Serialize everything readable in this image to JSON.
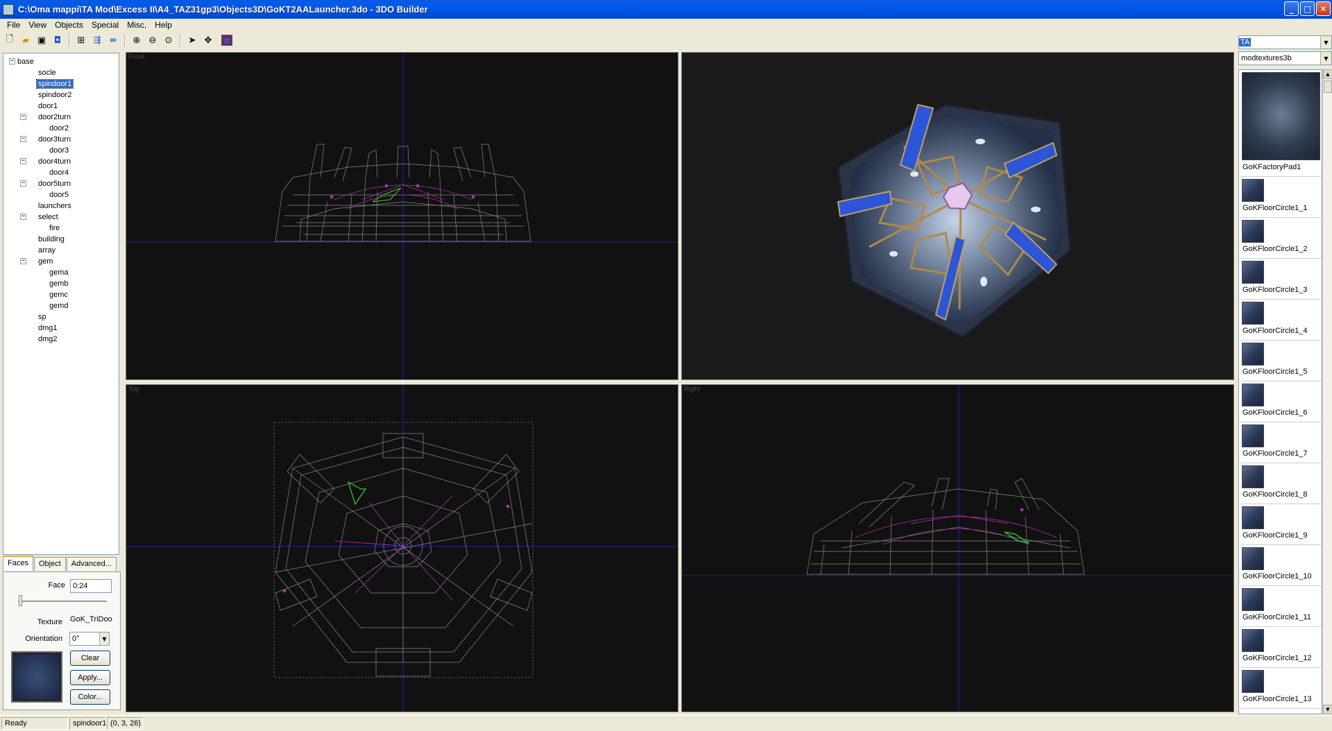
{
  "window": {
    "title": "C:\\Oma mappi\\TA Mod\\Excess II\\A4_TAZ31gp3\\Objects3D\\GoKT2AALauncher.3do - 3DO Builder",
    "buttons": {
      "minimize": "_",
      "maximize": "□",
      "close": "✕"
    }
  },
  "menu": [
    "File",
    "View",
    "Objects",
    "Special",
    "Misc.",
    "Help"
  ],
  "toolbar": {
    "icons": [
      "new-file-icon",
      "open-folder-icon",
      "save-disk-icon",
      "properties-icon",
      "add-object-icon",
      "merge-objects-icon",
      "split-objects-icon",
      "zoom-in-icon",
      "zoom-out-icon",
      "zoom-fit-icon",
      "select-arrow-icon",
      "move-cross-icon",
      "wireframe-toggle-icon"
    ]
  },
  "combos": {
    "mod": "TA",
    "texture_set": "modtextures3b"
  },
  "tree": {
    "items": [
      {
        "label": "base",
        "level": 0,
        "expandable": true,
        "selected": false
      },
      {
        "label": "socle",
        "level": 1,
        "expandable": false,
        "selected": false
      },
      {
        "label": "spindoor1",
        "level": 1,
        "expandable": false,
        "selected": true
      },
      {
        "label": "spindoor2",
        "level": 1,
        "expandable": false,
        "selected": false
      },
      {
        "label": "door1",
        "level": 1,
        "expandable": false,
        "selected": false
      },
      {
        "label": "door2turn",
        "level": 1,
        "expandable": true,
        "selected": false
      },
      {
        "label": "door2",
        "level": 2,
        "expandable": false,
        "selected": false
      },
      {
        "label": "door3turn",
        "level": 1,
        "expandable": true,
        "selected": false
      },
      {
        "label": "door3",
        "level": 2,
        "expandable": false,
        "selected": false
      },
      {
        "label": "door4turn",
        "level": 1,
        "expandable": true,
        "selected": false
      },
      {
        "label": "door4",
        "level": 2,
        "expandable": false,
        "selected": false
      },
      {
        "label": "door5turn",
        "level": 1,
        "expandable": true,
        "selected": false
      },
      {
        "label": "door5",
        "level": 2,
        "expandable": false,
        "selected": false
      },
      {
        "label": "launchers",
        "level": 1,
        "expandable": false,
        "selected": false
      },
      {
        "label": "select",
        "level": 1,
        "expandable": true,
        "selected": false
      },
      {
        "label": "fire",
        "level": 2,
        "expandable": false,
        "selected": false
      },
      {
        "label": "building",
        "level": 1,
        "expandable": false,
        "selected": false
      },
      {
        "label": "array",
        "level": 1,
        "expandable": false,
        "selected": false
      },
      {
        "label": "gem",
        "level": 1,
        "expandable": true,
        "selected": false
      },
      {
        "label": "gema",
        "level": 2,
        "expandable": false,
        "selected": false
      },
      {
        "label": "gemb",
        "level": 2,
        "expandable": false,
        "selected": false
      },
      {
        "label": "gemc",
        "level": 2,
        "expandable": false,
        "selected": false
      },
      {
        "label": "gemd",
        "level": 2,
        "expandable": false,
        "selected": false
      },
      {
        "label": "sp",
        "level": 1,
        "expandable": false,
        "selected": false
      },
      {
        "label": "dmg1",
        "level": 1,
        "expandable": false,
        "selected": false
      },
      {
        "label": "dmg2",
        "level": 1,
        "expandable": false,
        "selected": false
      }
    ]
  },
  "tabs": [
    "Faces",
    "Object",
    "Advanced..."
  ],
  "faces": {
    "face_label": "Face",
    "face_value": "0:24",
    "texture_label": "Texture",
    "texture_value": "GoK_TriDoo",
    "orientation_label": "Orientation",
    "orientation_value": "0°",
    "clear_button": "Clear",
    "apply_button": "Apply...",
    "color_button": "Color..."
  },
  "viewports": {
    "front": "Front",
    "top": "Top",
    "right": "Right"
  },
  "textures": [
    "GoKFactoryPad1",
    "GoKFloorCircle1_1",
    "GoKFloorCircle1_2",
    "GoKFloorCircle1_3",
    "GoKFloorCircle1_4",
    "GoKFloorCircle1_5",
    "GoKFloorCircle1_6",
    "GoKFloorCircle1_7",
    "GoKFloorCircle1_8",
    "GoKFloorCircle1_9",
    "GoKFloorCircle1_10",
    "GoKFloorCircle1_11",
    "GoKFloorCircle1_12",
    "GoKFloorCircle1_13"
  ],
  "status": {
    "state": "Ready",
    "object": "spindoor1",
    "coords": "(0, 3, 26)"
  },
  "colors": {
    "viewport_bg": "#111111",
    "axis": "#1f1fbf",
    "wire": "#8a8a8a",
    "selected_wire": "#b030b0",
    "selected_face": "#30d030"
  }
}
